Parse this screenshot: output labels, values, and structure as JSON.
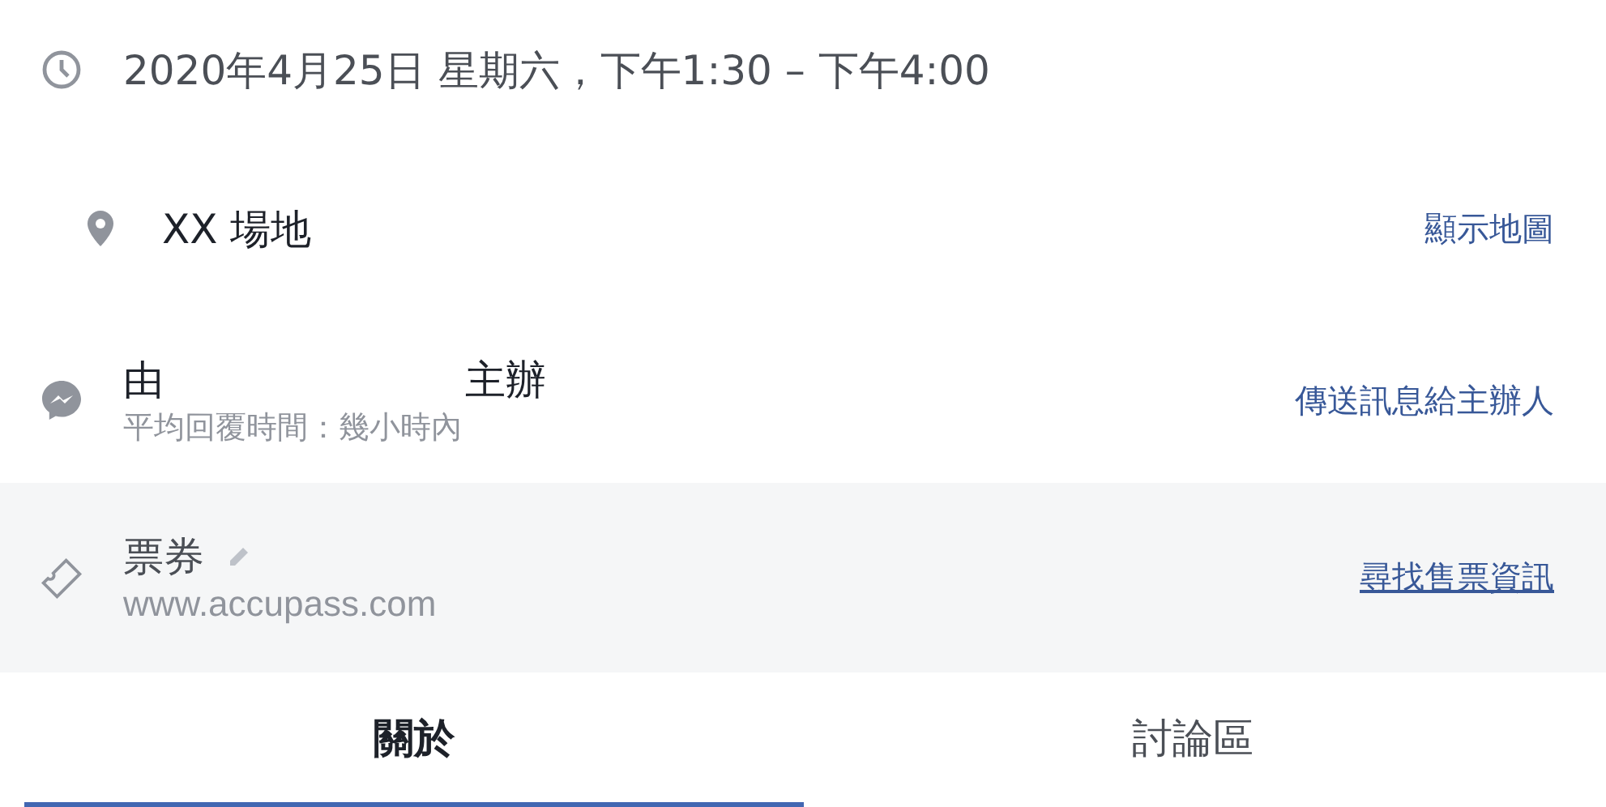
{
  "when": {
    "text": "2020年4月25日 星期六，下午1:30 – 下午4:00"
  },
  "location": {
    "name": "XX 場地",
    "link": "顯示地圖"
  },
  "host": {
    "prefix": "由",
    "suffix": "主辦",
    "response": "平均回覆時間：幾小時內",
    "link": "傳送訊息給主辦人"
  },
  "tickets": {
    "title": "票券",
    "site": "www.accupass.com",
    "link": "尋找售票資訊"
  },
  "tabs": [
    {
      "label": "關於",
      "selected": true
    },
    {
      "label": "討論區",
      "selected": false
    }
  ]
}
